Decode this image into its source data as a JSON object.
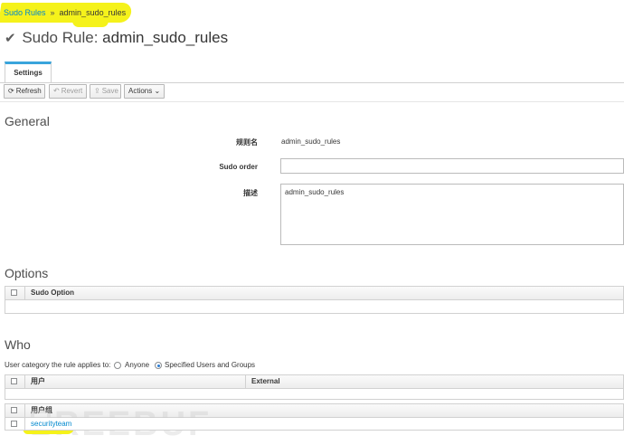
{
  "breadcrumb": {
    "root": "Sudo Rules",
    "separator": "»",
    "current": "admin_sudo_rules"
  },
  "page": {
    "title_prefix": "Sudo Rule:",
    "title_name": "admin_sudo_rules"
  },
  "tabs": [
    {
      "label": "Settings"
    }
  ],
  "toolbar": {
    "refresh": "Refresh",
    "revert": "Revert",
    "save": "Save",
    "actions": "Actions"
  },
  "general": {
    "heading": "General",
    "rule_name_label": "规则名",
    "rule_name_value": "admin_sudo_rules",
    "sudo_order_label": "Sudo order",
    "sudo_order_value": "",
    "description_label": "描述",
    "description_value": "admin_sudo_rules"
  },
  "options": {
    "heading": "Options",
    "column": "Sudo Option"
  },
  "who": {
    "heading": "Who",
    "category_label": "User category the rule applies to:",
    "radio_anyone": "Anyone",
    "radio_specified": "Specified Users and Groups",
    "users_column": "用户",
    "external_column": "External",
    "groups_column": "用户组",
    "groups": [
      "securityteam"
    ]
  },
  "watermark": "REEBUF",
  "colors": {
    "accent": "#39a5dc",
    "link": "#0088ce",
    "highlight": "#f5f21b"
  }
}
